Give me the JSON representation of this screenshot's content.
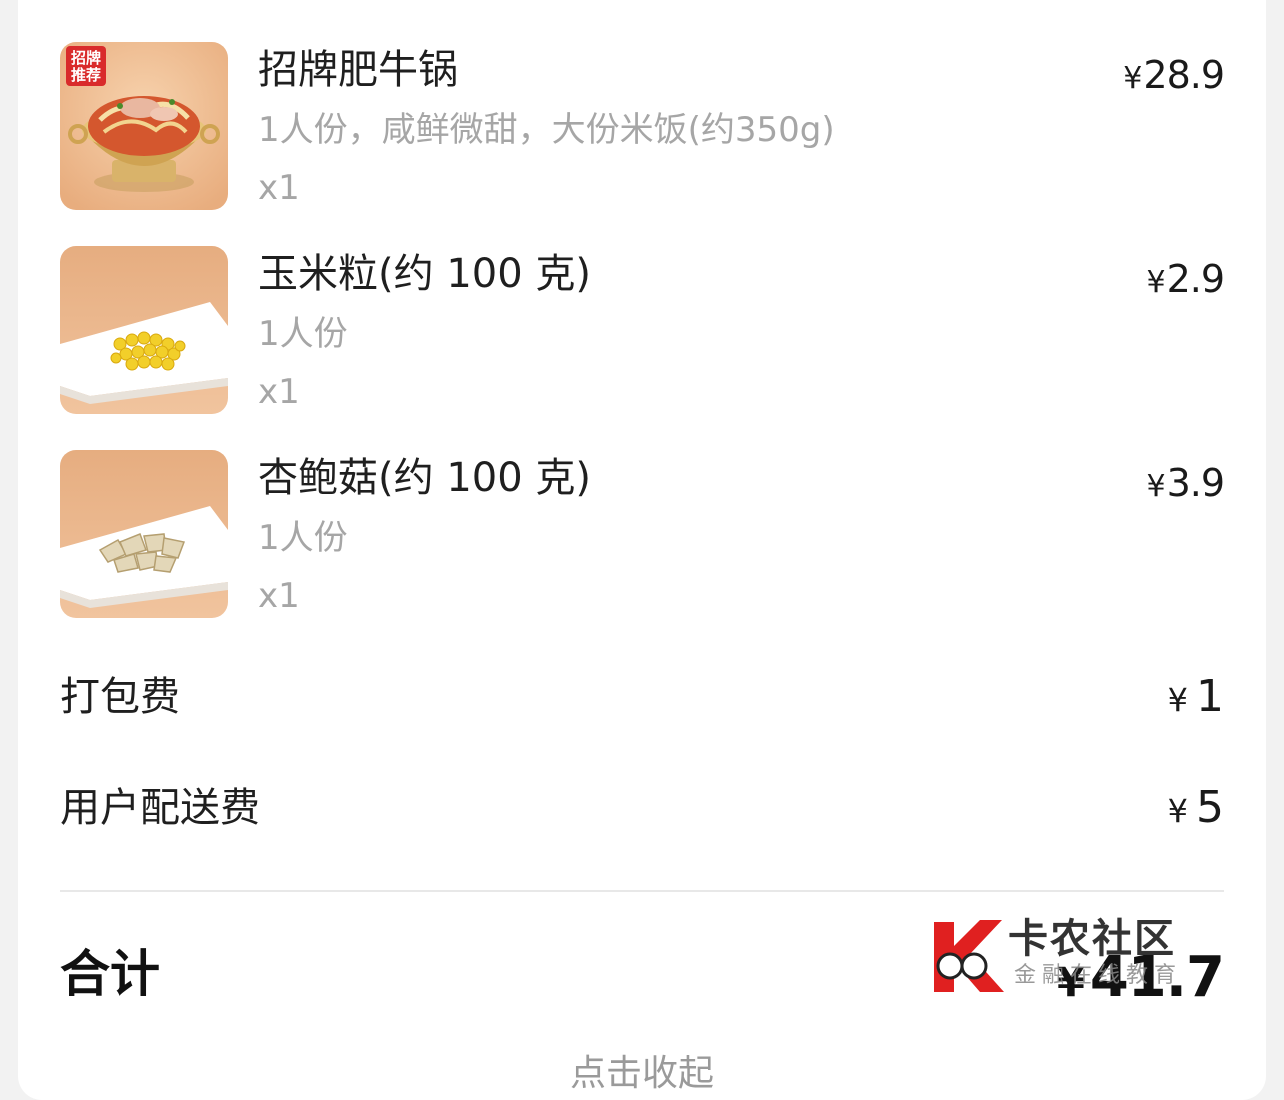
{
  "order": {
    "items": [
      {
        "name": "招牌肥牛锅",
        "spec": "1人份，咸鲜微甜，大份米饭(约350g)",
        "qty": "x1",
        "price": "28.9",
        "badge": "招牌推荐",
        "image_icon": "beef-hotpot-image"
      },
      {
        "name": "玉米粒(约 100 克)",
        "spec": "1人份",
        "qty": "x1",
        "price": "2.9",
        "image_icon": "corn-plate-image"
      },
      {
        "name": "杏鲍菇(约 100 克)",
        "spec": "1人份",
        "qty": "x1",
        "price": "3.9",
        "image_icon": "mushroom-plate-image"
      }
    ],
    "currency_symbol": "¥",
    "fees": [
      {
        "label": "打包费",
        "value": "1"
      },
      {
        "label": "用户配送费",
        "value": "5"
      }
    ],
    "total": {
      "label": "合计",
      "value": "41.7"
    },
    "collapse_label": "点击收起"
  },
  "watermark": {
    "title": "卡农社区",
    "subtitle": "金融在线教育"
  },
  "colors": {
    "page_bg": "#f2f2f2",
    "card_bg": "#ffffff",
    "text_primary": "#1f1f1f",
    "text_secondary": "#a6a6a6",
    "thumb_bg": "#e9b487",
    "watermark_red": "#e02020"
  }
}
